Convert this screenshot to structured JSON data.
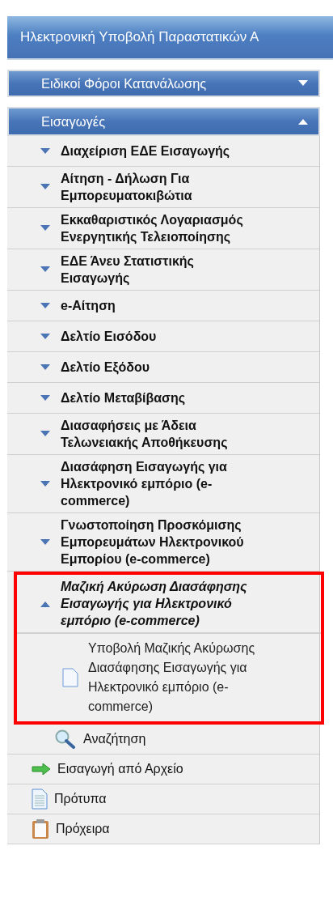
{
  "banner": {
    "title": "Ηλεκτρονική Υποβολή Παραστατικών Α"
  },
  "sections": [
    {
      "title": "Ειδικοί Φόροι Κατανάλωσης",
      "expanded": false
    },
    {
      "title": "Εισαγωγές",
      "expanded": true,
      "items": [
        {
          "label": "Διαχείριση ΕΔΕ Εισαγωγής",
          "expanded": false,
          "selected": false,
          "highlighted": false
        },
        {
          "label": "Αίτηση - Δήλωση Για Εμπορευματοκιβώτια",
          "expanded": false,
          "selected": false,
          "highlighted": false
        },
        {
          "label": "Εκκαθαριστικός Λογαριασμός Ενεργητικής Τελειοποίησης",
          "expanded": false,
          "selected": false,
          "highlighted": false
        },
        {
          "label": "ΕΔΕ Άνευ Στατιστικής Εισαγωγής",
          "expanded": false,
          "selected": false,
          "highlighted": false
        },
        {
          "label": "e-Αίτηση",
          "expanded": false,
          "selected": false,
          "highlighted": false
        },
        {
          "label": "Δελτίο Εισόδου",
          "expanded": false,
          "selected": false,
          "highlighted": false
        },
        {
          "label": "Δελτίο Εξόδου",
          "expanded": false,
          "selected": false,
          "highlighted": false
        },
        {
          "label": "Δελτίο Μεταβίβασης",
          "expanded": false,
          "selected": false,
          "highlighted": false
        },
        {
          "label": "Διασαφήσεις με Άδεια Τελωνειακής Αποθήκευσης",
          "expanded": false,
          "selected": false,
          "highlighted": false
        },
        {
          "label": "Διασάφηση Εισαγωγής για Ηλεκτρονικό εμπόριο (e-commerce)",
          "expanded": false,
          "selected": false,
          "highlighted": false
        },
        {
          "label": "Γνωστοποίηση Προσκόμισης Εμπορευμάτων Ηλεκτρονικού Εμπορίου (e-commerce)",
          "expanded": false,
          "selected": false,
          "highlighted": false
        },
        {
          "label": "Μαζική Ακύρωση Διασάφησης Εισαγωγής για Ηλεκτρονικό εμπόριο (e-commerce)",
          "expanded": true,
          "selected": true,
          "highlighted": true,
          "children": [
            {
              "label": "Υποβολή Μαζικής Ακύρωσης Διασάφησης Εισαγωγής για Ηλεκτρονικό εμπόριο (e-commerce)"
            }
          ]
        }
      ]
    }
  ],
  "tools": [
    {
      "kind": "search",
      "label": "Αναζήτηση"
    },
    {
      "kind": "import",
      "label": "Εισαγωγή από Αρχείο"
    },
    {
      "kind": "templates",
      "label": "Πρότυπα"
    },
    {
      "kind": "drafts",
      "label": "Πρόχειρα"
    }
  ]
}
